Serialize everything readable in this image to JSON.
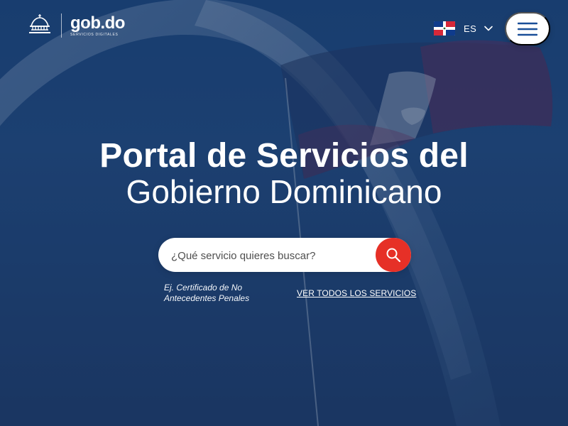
{
  "header": {
    "brand": {
      "main": "gob.do",
      "sub": "SERVICIOS DIGITALES"
    },
    "language": {
      "selected": "ES"
    },
    "icons": {
      "logo": "national-palace-icon",
      "flag": "dominican-republic-flag-icon",
      "language_dropdown": "chevron-down-icon",
      "menu": "hamburger-menu-icon"
    }
  },
  "hero": {
    "title_line_1": "Portal de Servicios del",
    "title_line_2": "Gobierno Dominicano"
  },
  "search": {
    "placeholder": "¿Qué servicio quieres buscar?",
    "button_icon": "search-icon"
  },
  "links": {
    "example": "Ej. Certificado de No\nAntecedentes Penales",
    "view_all": "VER TODOS LOS SERVICIOS"
  },
  "colors": {
    "background_blue": "#244f86",
    "accent_red": "#e63027",
    "white": "#ffffff",
    "flag_blue": "#0f3b8c",
    "flag_red": "#d62839"
  }
}
